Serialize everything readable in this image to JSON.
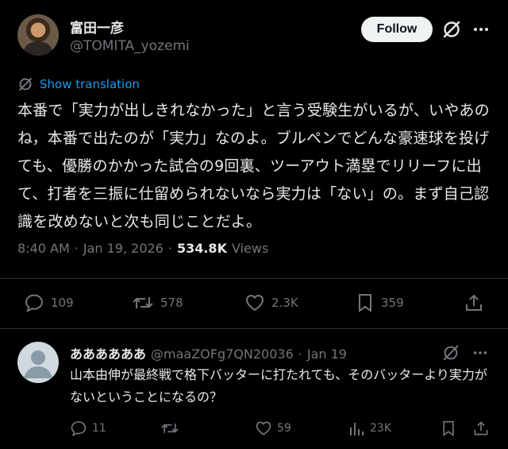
{
  "author": {
    "name": "富田一彦",
    "handle": "@TOMITA_yozemi",
    "follow_label": "Follow"
  },
  "tweet": {
    "translate_label": "Show translation",
    "text": "本番で「実力が出しきれなかった」と言う受験生がいるが、いやあのね，本番で出たのが「実力」なのよ。ブルペンでどんな豪速球を投げても、優勝のかかった試合の9回裏、ツーアウト満塁でリリーフに出て、打者を三振に仕留められないなら実力は「ない」の。まず自己認識を改めないと次も同じことだよ。",
    "time": "8:40 AM",
    "date": "Jan 19, 2026",
    "views_count": "534.8K",
    "views_label": "Views",
    "separator": "·"
  },
  "actions": {
    "replies": "109",
    "reposts": "578",
    "likes": "2.3K",
    "bookmarks": "359"
  },
  "reply": {
    "name": "ああああああ",
    "handle": "@maaZOFg7QN20036",
    "separator": "·",
    "date": "Jan 19",
    "text": "山本由伸が最終戦で格下バッターに打たれても、そのバッターより実力がないということになるの？",
    "actions": {
      "replies": "11",
      "reposts": "",
      "likes": "59",
      "views": "23K"
    }
  },
  "colors": {
    "background": "#000000",
    "text": "#e7e9ea",
    "muted": "#71767b",
    "link": "#1d9bf0",
    "divider": "#2f3336",
    "follow_bg": "#eff3f4"
  }
}
